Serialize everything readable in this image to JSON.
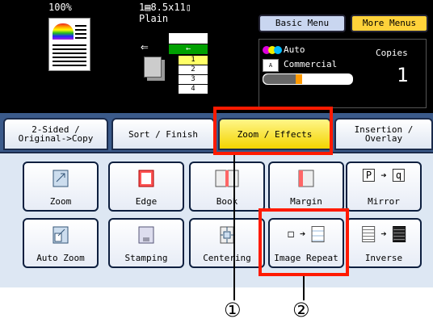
{
  "status": {
    "zoom_percent": "100%",
    "paper_size": "1▤8.5x11▯",
    "paper_type": "Plain",
    "tray_numbers": [
      "1",
      "2",
      "3",
      "4"
    ],
    "color_mode": "Auto",
    "original_type": "Commercial",
    "copies_label": "Copies",
    "copies_value": "1"
  },
  "menu_buttons": {
    "basic_menu": "Basic Menu",
    "more_menus": "More Menus"
  },
  "tabs": [
    {
      "label": "2-Sided /\nOriginal->Copy"
    },
    {
      "label": "Sort / Finish"
    },
    {
      "label": "Zoom / Effects"
    },
    {
      "label": "Insertion /\nOverlay"
    }
  ],
  "functions": [
    {
      "label": "Zoom",
      "icon": "zoom-icon"
    },
    {
      "label": "Edge",
      "icon": "edge-icon"
    },
    {
      "label": "Book",
      "icon": "book-icon"
    },
    {
      "label": "Margin",
      "icon": "margin-icon"
    },
    {
      "label": "Mirror",
      "icon": "mirror-icon"
    },
    {
      "label": "Auto Zoom",
      "icon": "auto-zoom-icon"
    },
    {
      "label": "Stamping",
      "icon": "stamping-icon"
    },
    {
      "label": "Centering",
      "icon": "centering-icon"
    },
    {
      "label": "Image Repeat",
      "icon": "image-repeat-icon"
    },
    {
      "label": "Inverse",
      "icon": "inverse-icon"
    }
  ],
  "callouts": [
    "①",
    "②"
  ],
  "colors": {
    "highlight": "#ff1a00",
    "active_tab": "#f3d400",
    "more_menus": "#ffd23a",
    "basic_menu": "#c9d6f0"
  }
}
